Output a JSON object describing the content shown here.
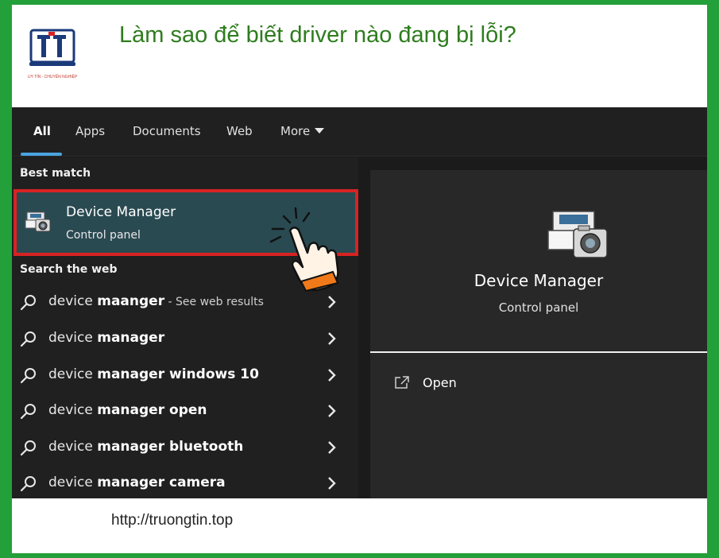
{
  "header": {
    "headline": "Làm sao để biết driver nào đang bị lỗi?",
    "logo_tagline": "UY TÍN - CHUYÊN NGHIỆP",
    "footer_url": "http://truongtin.top"
  },
  "tabs": [
    {
      "label": "All",
      "active": true
    },
    {
      "label": "Apps"
    },
    {
      "label": "Documents"
    },
    {
      "label": "Web"
    },
    {
      "label": "More"
    }
  ],
  "best_match": {
    "section_label": "Best match",
    "title": "Device Manager",
    "subtitle": "Control panel"
  },
  "web": {
    "section_label": "Search the web",
    "items": [
      {
        "prefix": "device ",
        "bold": "maanger",
        "hint": " - See web results"
      },
      {
        "prefix": "device ",
        "bold": "manager",
        "hint": ""
      },
      {
        "prefix": "device ",
        "bold": "manager windows 10",
        "hint": ""
      },
      {
        "prefix": "device ",
        "bold": "manager open",
        "hint": ""
      },
      {
        "prefix": "device ",
        "bold": "manager bluetooth",
        "hint": ""
      },
      {
        "prefix": "device ",
        "bold": "manager camera",
        "hint": ""
      }
    ]
  },
  "preview": {
    "title": "Device Manager",
    "subtitle": "Control panel",
    "open_label": "Open"
  },
  "colors": {
    "border_green": "#23a03a",
    "headline_green": "#2e7d1e",
    "highlight_red": "#d82323",
    "selected_bg": "#2a4a52",
    "tab_accent": "#4aa3df"
  }
}
